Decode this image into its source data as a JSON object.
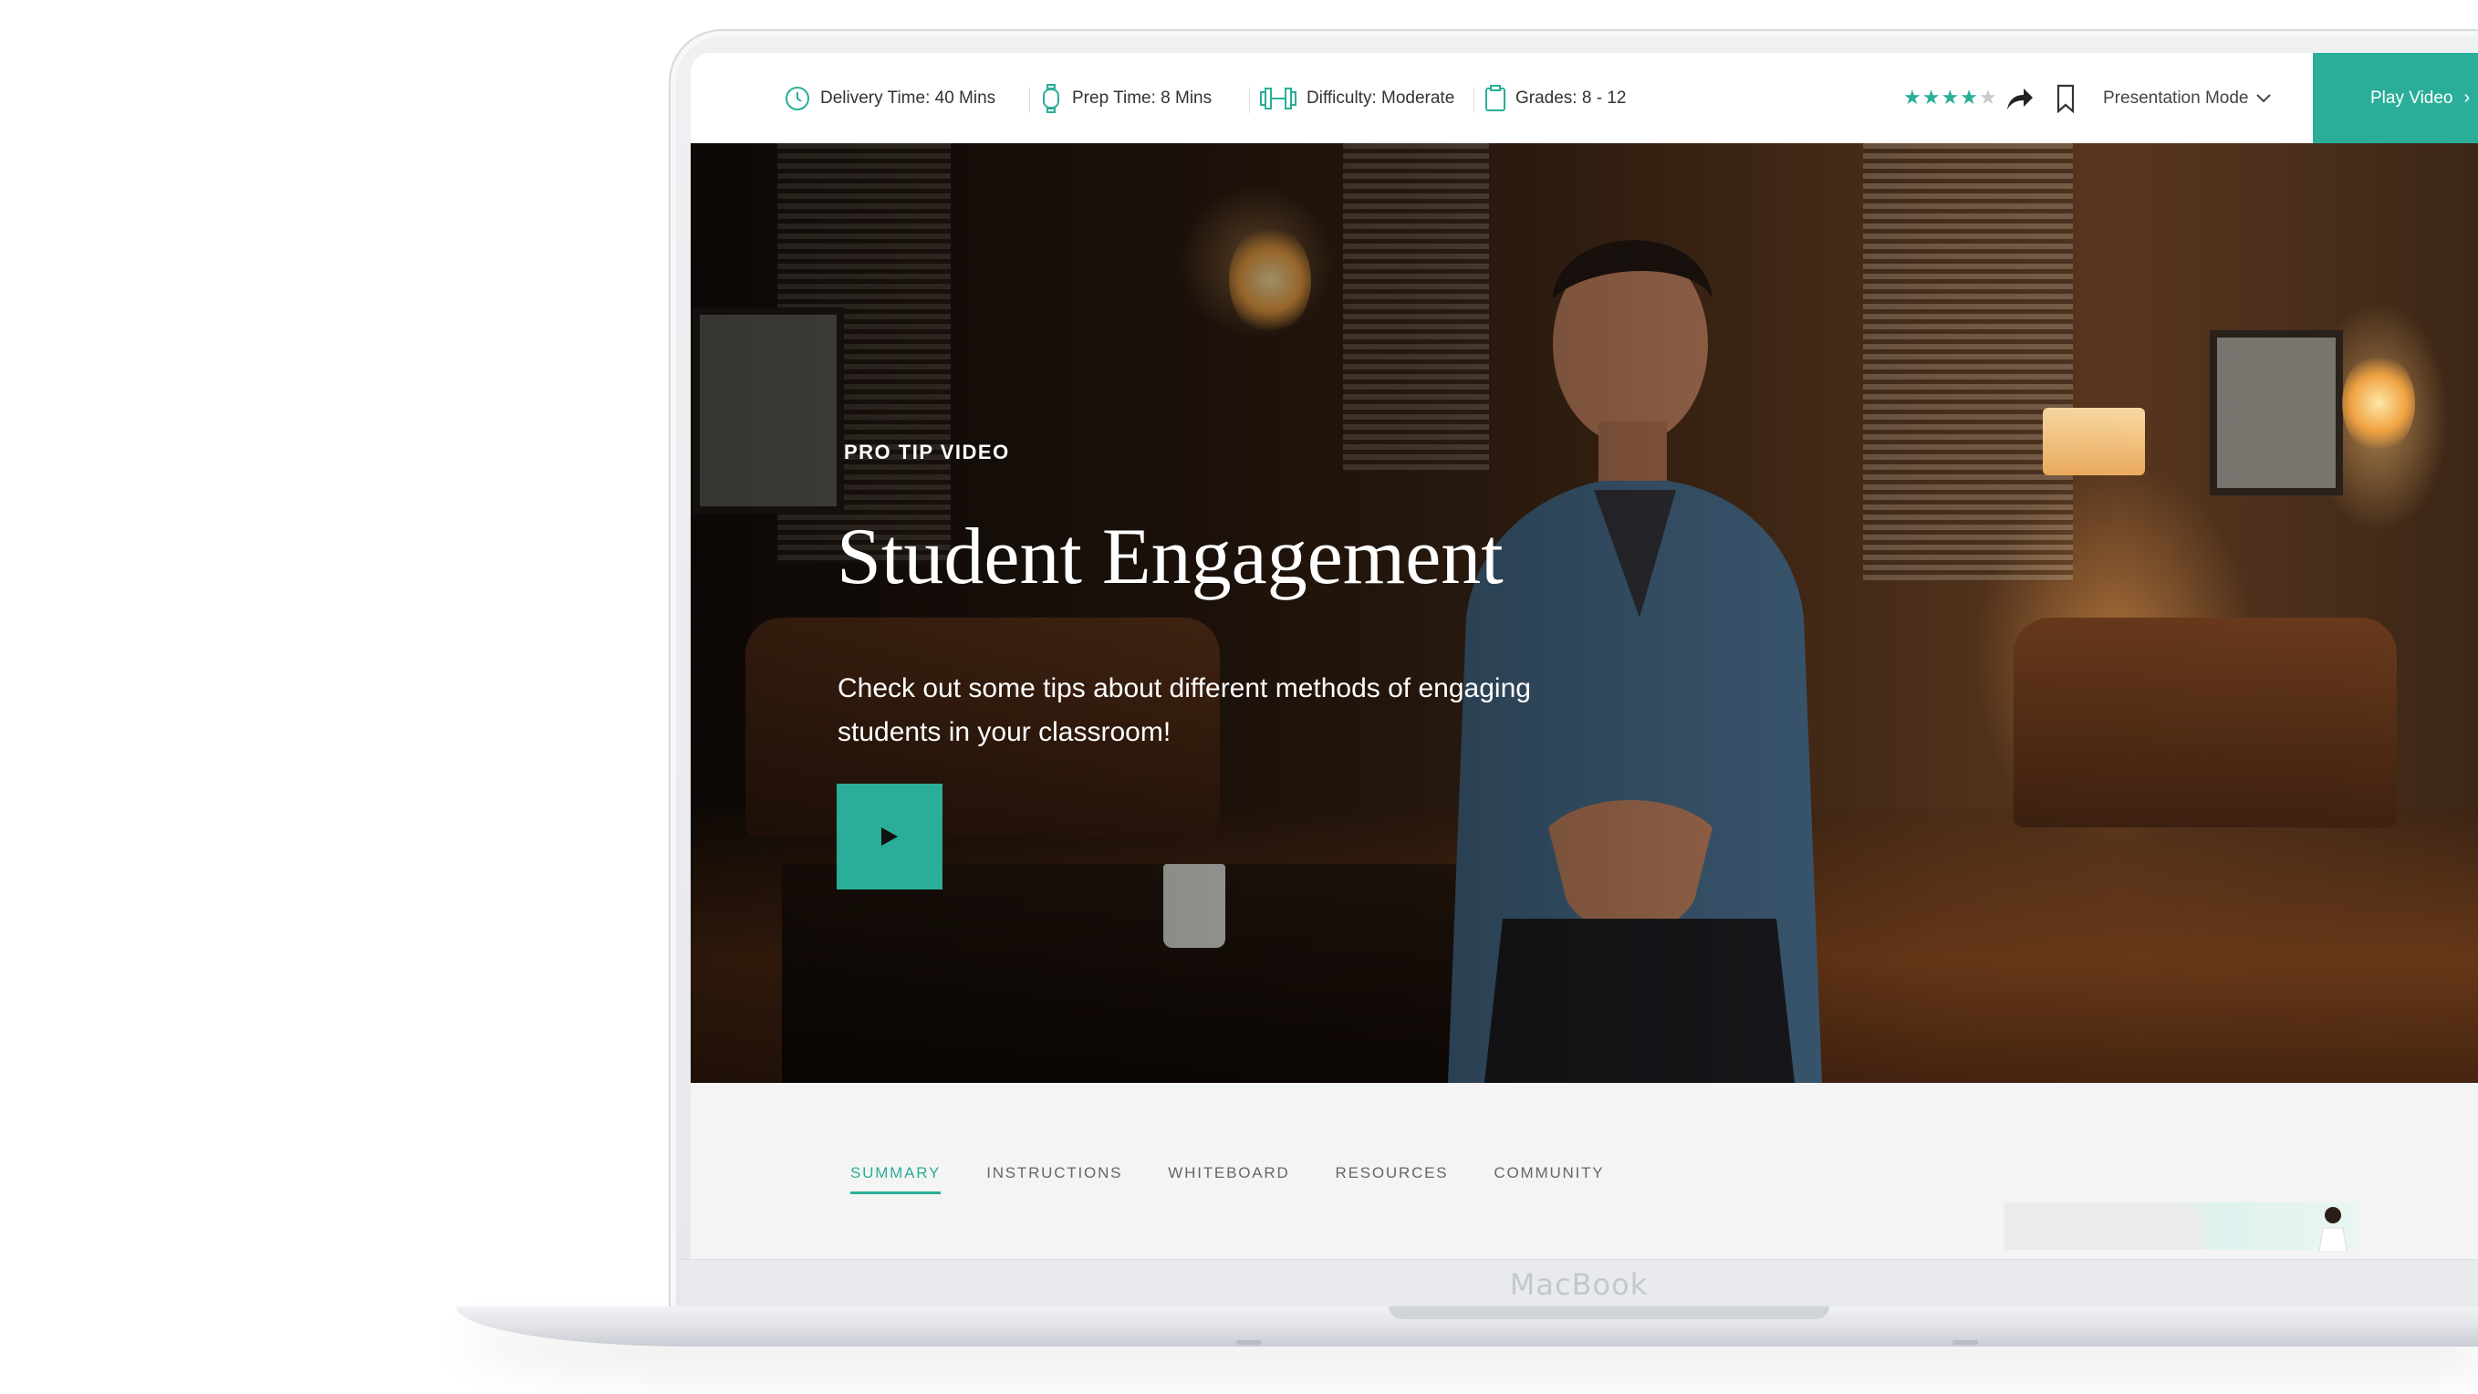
{
  "topbar": {
    "meta": [
      {
        "icon": "clock-icon",
        "label": "Delivery Time: 40 Mins"
      },
      {
        "icon": "stopwatch-icon",
        "label": "Prep Time: 8 Mins"
      },
      {
        "icon": "dumbbell-icon",
        "label": "Difficulty: Moderate"
      },
      {
        "icon": "clipboard-icon",
        "label": "Grades: 8 - 12"
      }
    ],
    "rating": {
      "value": 4,
      "max": 5
    },
    "presentation_mode_label": "Presentation Mode",
    "play_video_label": "Play Video",
    "play_video_chevron": "›"
  },
  "hero": {
    "eyebrow": "PRO TIP VIDEO",
    "title": "Student Engagement",
    "subtitle": "Check out some tips about different methods of engaging students in your classroom!"
  },
  "tabs": [
    {
      "label": "SUMMARY",
      "active": true
    },
    {
      "label": "INSTRUCTIONS",
      "active": false
    },
    {
      "label": "WHITEBOARD",
      "active": false
    },
    {
      "label": "RESOURCES",
      "active": false
    },
    {
      "label": "COMMUNITY",
      "active": false
    }
  ],
  "device": {
    "brand": "MacBook"
  },
  "colors": {
    "accent": "#2aae99"
  }
}
